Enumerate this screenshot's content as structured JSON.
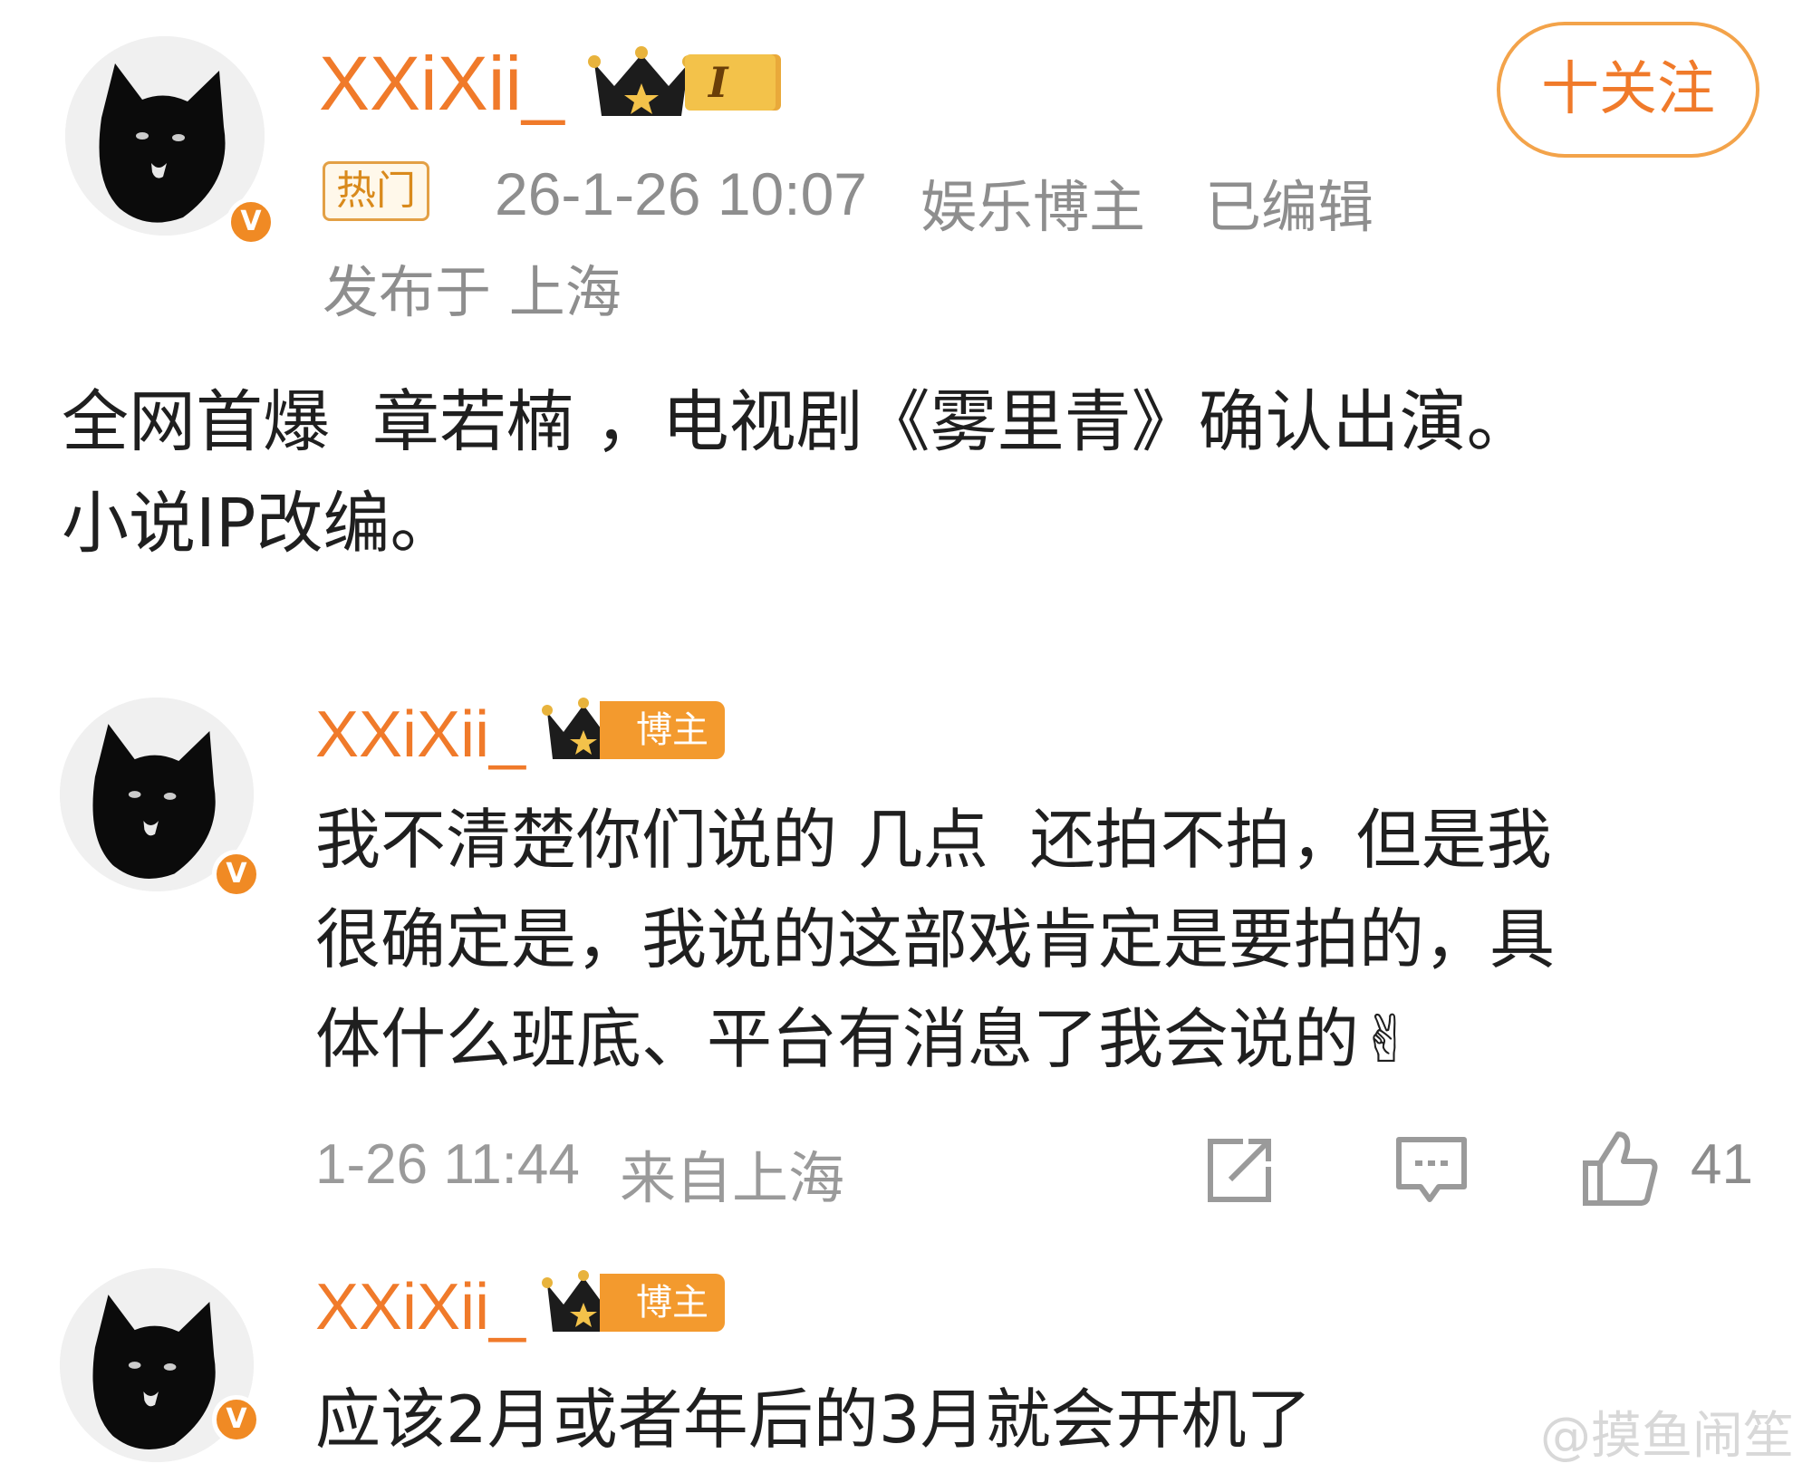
{
  "post": {
    "username": "XXiXii_",
    "level_badge": "I",
    "hot_tag": "热门",
    "timestamp": "26-1-26 10:07",
    "category": "娱乐博主",
    "edited": "已编辑",
    "location": "发布于 上海",
    "follow_label": "十关注",
    "text_line1": "全网首爆  章若楠 ，电视剧《雾里青》确认出演。",
    "text_line2": "小说IP改编。"
  },
  "replies": [
    {
      "username": "XXiXii_",
      "blogger_tag": "博主",
      "text_line1": "我不清楚你们说的 几点  还拍不拍，但是我",
      "text_line2": "很确定是，我说的这部戏肯定是要拍的，具",
      "text_line3": "体什么班底、平台有消息了我会说的✌",
      "time": "1-26 11:44",
      "location": "来自上海",
      "like_count": "41"
    },
    {
      "username": "XXiXii_",
      "blogger_tag": "博主",
      "text_line1": "应该2月或者年后的3月就会开机了"
    }
  ],
  "verified_badge": "V",
  "watermark": "@摸鱼闹笙",
  "colors": {
    "accent": "#f07a2a",
    "meta_gray": "#8e8e8e",
    "badge_orange": "#f08a24"
  },
  "icons": [
    "verified-icon",
    "crown-icon",
    "share-icon",
    "comment-icon",
    "like-icon"
  ]
}
